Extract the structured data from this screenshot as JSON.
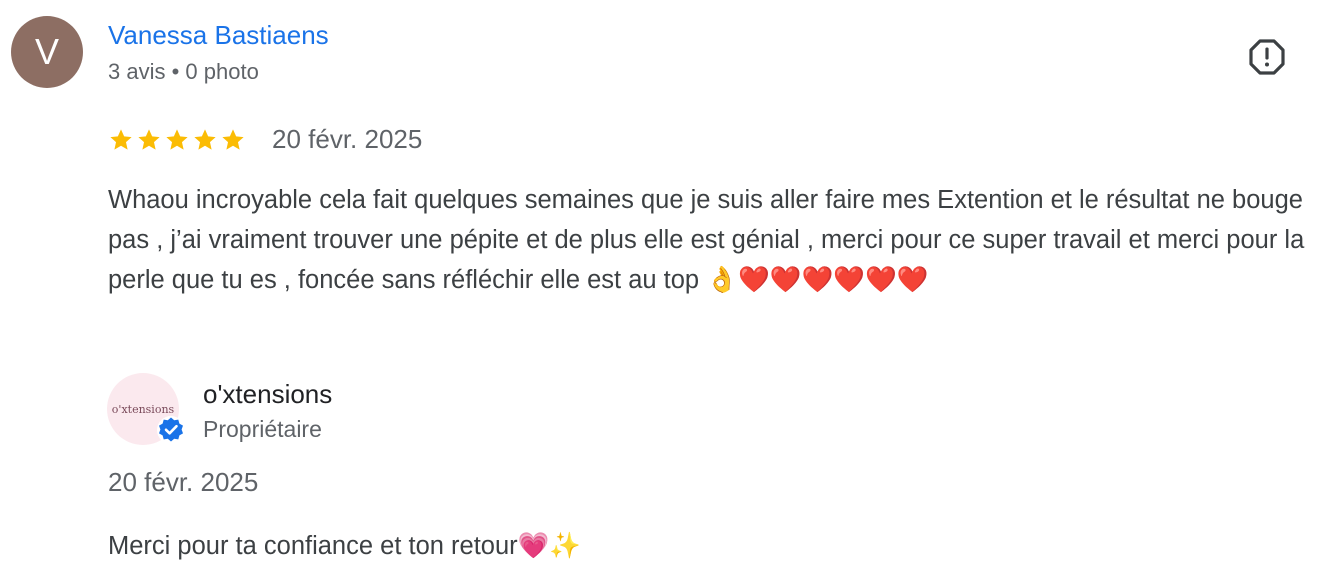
{
  "review": {
    "reviewer": {
      "initial": "V",
      "name": "Vanessa Bastiaens",
      "meta": "3 avis • 0 photo",
      "avatar_color": "#8d6e63"
    },
    "rating": 5,
    "rating_max": 5,
    "star_color": "#fbbc04",
    "date": "20 févr. 2025",
    "text": "Whaou incroyable cela fait quelques semaines que je suis aller faire mes Extention et le résultat ne bouge pas , j’ai vraiment trouver une pépite et de plus elle est génial , merci pour ce super travail et merci pour la perle que tu es , foncée sans réfléchir elle est au top 👌❤️❤️❤️❤️❤️❤️"
  },
  "owner_reply": {
    "avatar_text": "o'xtensions",
    "name": "o'xtensions",
    "role": "Propriétaire",
    "date": "20 févr. 2025",
    "text": "Merci pour ta confiance et ton retour💗✨",
    "verified_color": "#1a73e8"
  },
  "icons": {
    "report": "report-flag-icon",
    "star": "star-icon",
    "verified": "verified-badge-icon"
  }
}
